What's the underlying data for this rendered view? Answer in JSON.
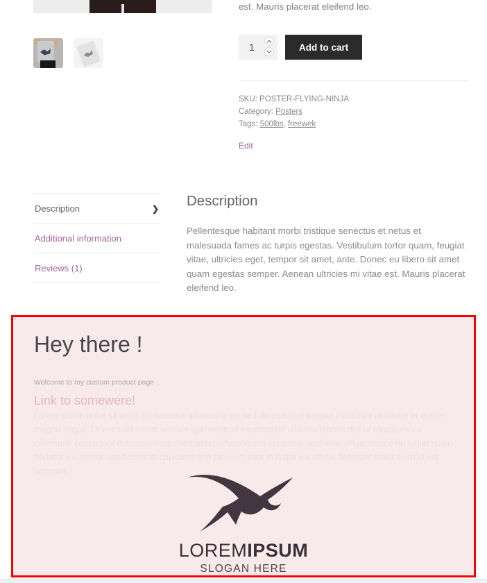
{
  "product": {
    "excerpt_tail": "est. Mauris placerat eleifend leo.",
    "quantity_value": "1",
    "quantity_placeholder": "1",
    "add_to_cart_label": "Add to cart",
    "sku_label": "SKU:",
    "sku_value": "POSTER-FLYING-NINJA",
    "category_label": "Category:",
    "category_value": "Posters",
    "tags_label": "Tags:",
    "tags": [
      "500lbs",
      "freewek"
    ],
    "tags_separator": ", ",
    "edit_label": "Edit",
    "gallery": {
      "main_alt": "flying-ninja-poster-held",
      "thumbs": [
        "poster-held-by-person",
        "poster-lying-flat"
      ]
    }
  },
  "tabs": {
    "items": [
      {
        "label": "Description",
        "active": true
      },
      {
        "label": "Additional information",
        "active": false
      },
      {
        "label": "Reviews (1)",
        "active": false
      }
    ],
    "panel": {
      "title": "Description",
      "body": "Pellentesque habitant morbi tristique senectus et netus et malesuada fames ac turpis egestas. Vestibulum tortor quam, feugiat vitae, ultricies eget, tempor sit amet, ante. Donec eu libero sit amet quam egestas semper. Aenean ultricies mi vitae est. Mauris placerat eleifend leo."
    }
  },
  "custom_block": {
    "heading": "Hey there !",
    "welcome": "Welcome to my custom product page",
    "link_label": "Link to somewere!",
    "ghost_text": "Lorem ipsum dolor sit amet consectetur adipiscing elit sed do eiusmod tempor incididunt ut labore et dolore magna aliqua. Ut enim ad minim veniam quis nostrud exercitation ullamco laboris nisi ut aliquip ex ea commodo consequat duis aute irure dolor in reprehenderit in voluptate velit esse cillum dolore eu fugiat nulla pariatur excepteur sint occaecat cupidatat non proident sunt in culpa qui officia deserunt mollit anim id est laborum.",
    "logo": {
      "icon": "flying-bird-logo",
      "name_light": "LOREM",
      "name_bold": "IPSUM",
      "slogan": "SLOGAN HERE"
    },
    "border_color": "#fc0000",
    "background_color": "#f8eaea"
  },
  "colors": {
    "accent_link": "#a46497",
    "button_dark": "#2b2b2b",
    "text_muted": "#8a8a8a"
  }
}
